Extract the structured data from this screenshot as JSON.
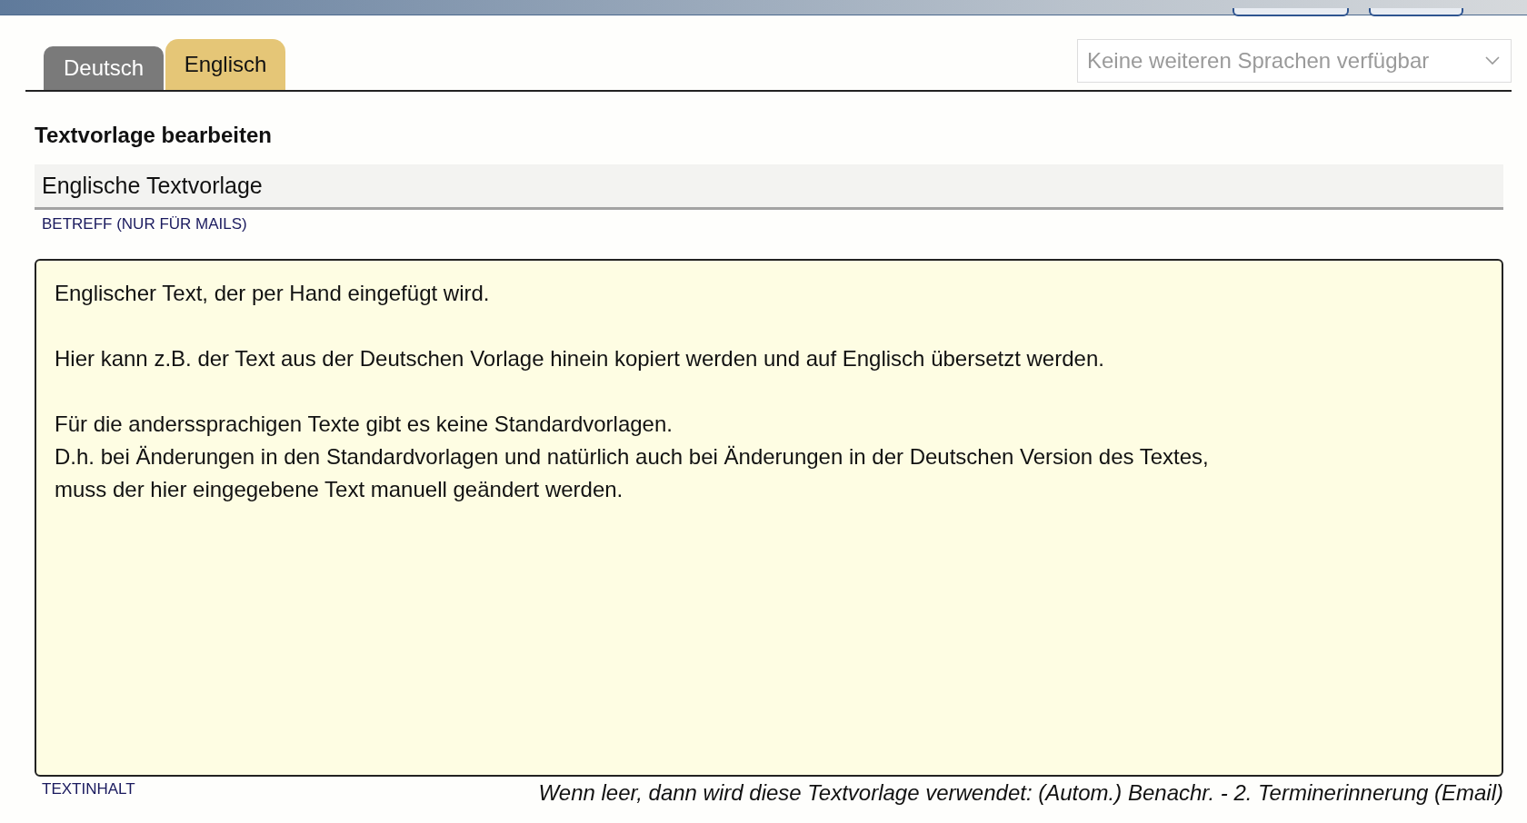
{
  "tabs": [
    {
      "label": "Deutsch",
      "selected": false
    },
    {
      "label": "Englisch",
      "selected": true
    }
  ],
  "language_select": {
    "placeholder": "Keine weiteren Sprachen verfügbar",
    "disabled": true
  },
  "heading": "Textvorlage bearbeiten",
  "subject": {
    "value": "Englische Textvorlage",
    "label": "BETREFF (NUR FÜR MAILS)"
  },
  "content": {
    "value": "Englischer Text, der per Hand eingefügt wird.\n\nHier kann z.B. der Text aus der Deutschen Vorlage hinein kopiert werden und auf Englisch übersetzt werden.\n\nFür die anderssprachigen Texte gibt es keine Standardvorlagen.\nD.h. bei Änderungen in den Standardvorlagen und natürlich auch bei Änderungen in der Deutschen Version des Textes,\nmuss der hier eingegebene Text manuell geändert werden.",
    "label": "TEXTINHALT",
    "hint": "Wenn leer, dann wird diese Textvorlage verwendet: (Autom.) Benachr. - 2. Terminerinnerung (Email)"
  }
}
